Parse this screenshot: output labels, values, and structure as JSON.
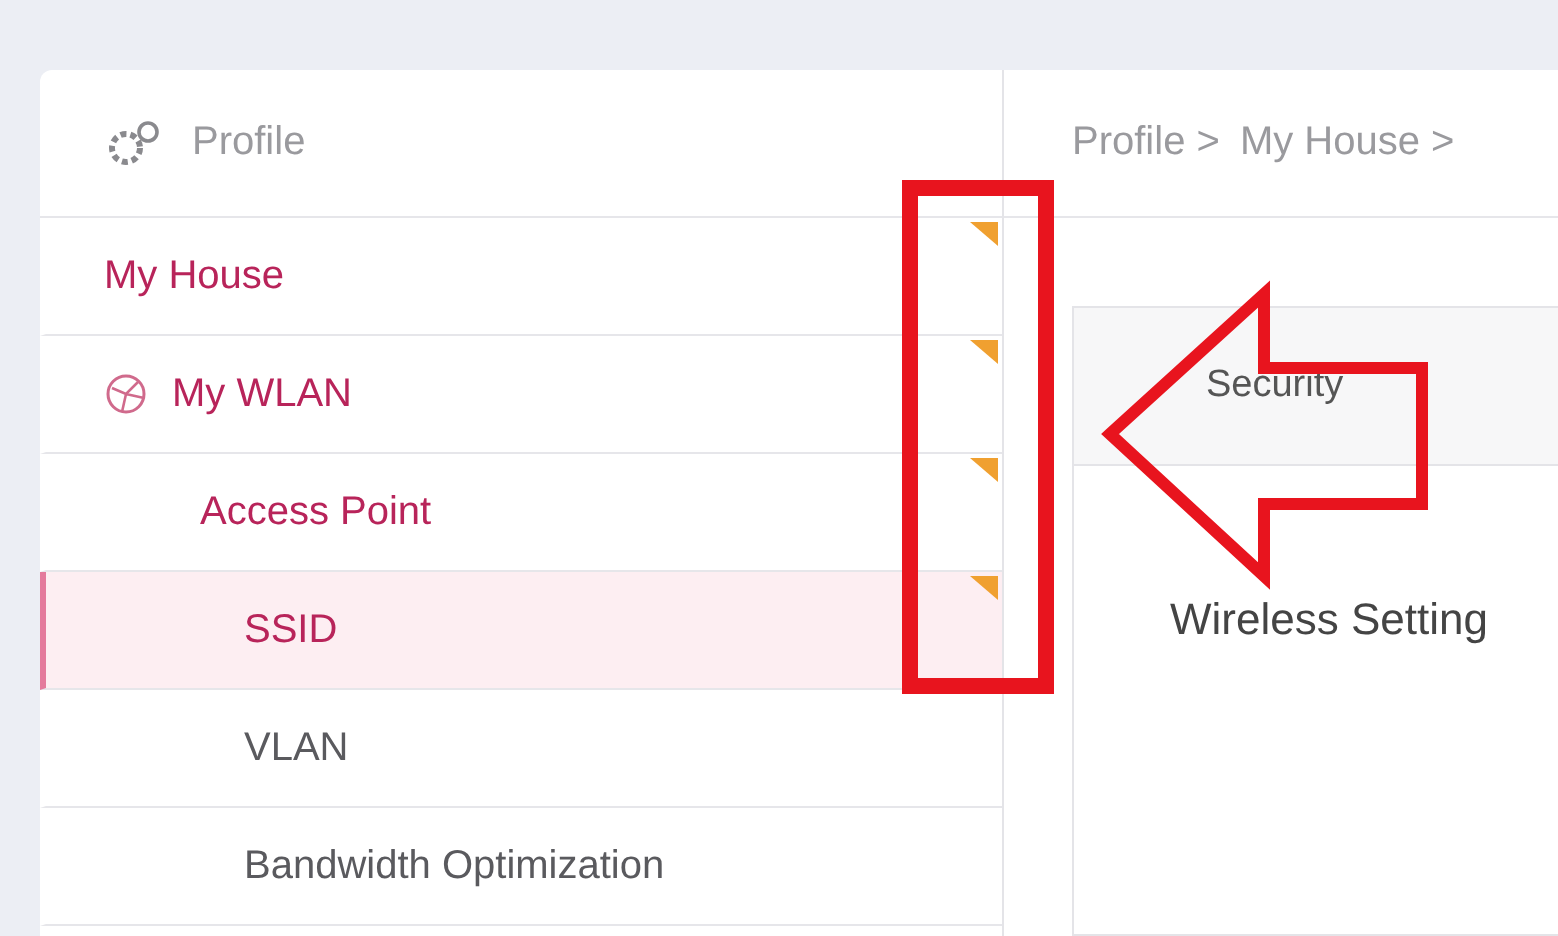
{
  "sidebar": {
    "header": "Profile",
    "items": [
      {
        "label": "My House",
        "icon": false,
        "active": true,
        "selected": false,
        "marked": true,
        "children": [
          {
            "label": "My WLAN",
            "icon": true,
            "active": true,
            "selected": false,
            "marked": true,
            "children": [
              {
                "label": "Access Point",
                "icon": false,
                "active": true,
                "selected": false,
                "marked": true,
                "children": [
                  {
                    "label": "SSID",
                    "icon": false,
                    "active": true,
                    "selected": true,
                    "marked": true
                  },
                  {
                    "label": "VLAN",
                    "icon": false,
                    "active": false,
                    "selected": false,
                    "marked": false
                  },
                  {
                    "label": "Bandwidth Optimization",
                    "icon": false,
                    "active": false,
                    "selected": false,
                    "marked": false
                  }
                ]
              }
            ]
          }
        ]
      }
    ]
  },
  "breadcrumb": [
    "Profile >",
    "My House >"
  ],
  "panel": {
    "tab": "Security",
    "heading": "Wireless Setting"
  },
  "annotations": {
    "highlight_rectangle": true,
    "arrow": true
  }
}
